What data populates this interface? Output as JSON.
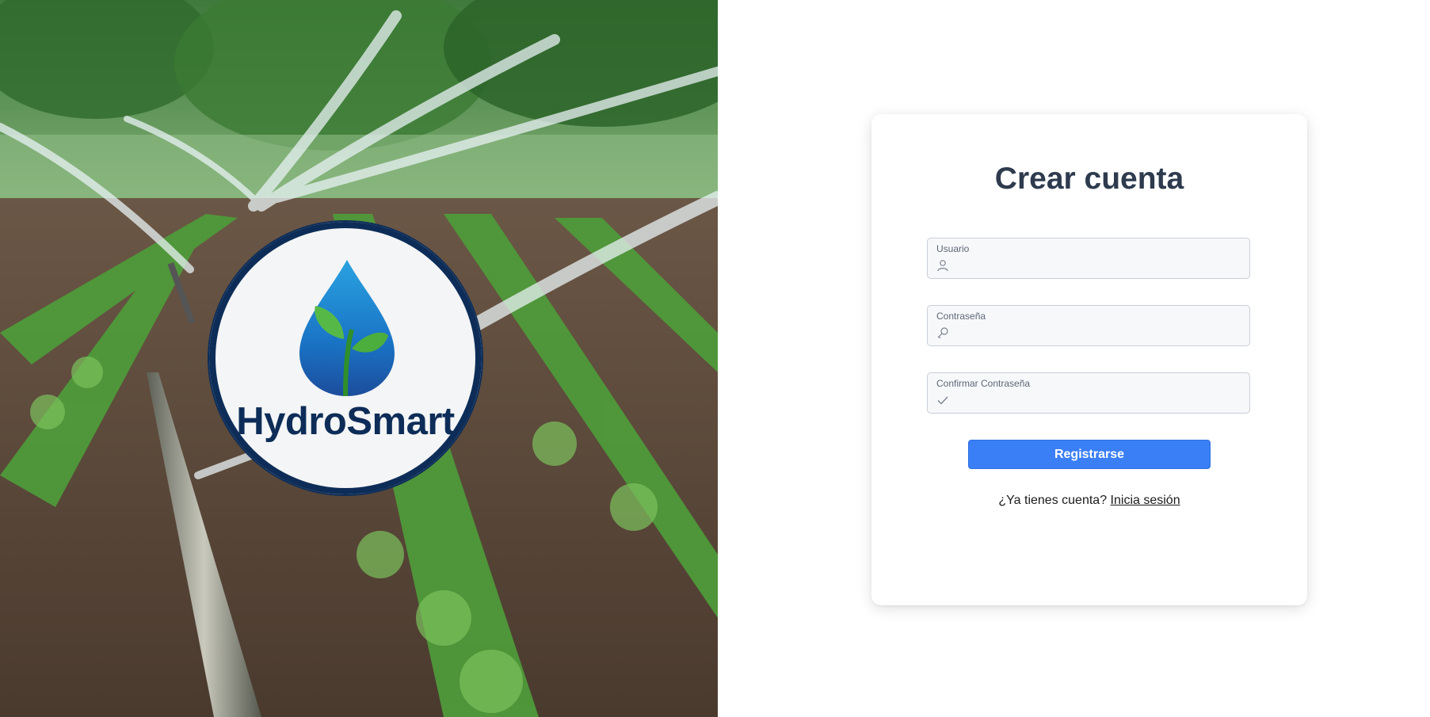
{
  "brand": {
    "name": "HydroSmart"
  },
  "form": {
    "title": "Crear cuenta",
    "fields": [
      {
        "label": "Usuario",
        "value": "",
        "icon": "user-icon"
      },
      {
        "label": "Contraseña",
        "value": "",
        "icon": "key-icon"
      },
      {
        "label": "Confirmar Contraseña",
        "value": "",
        "icon": "check-icon"
      }
    ],
    "submit_label": "Registrarse",
    "login_prompt": "¿Ya tienes cuenta?",
    "login_link": "Inicia sesión"
  },
  "colors": {
    "accent": "#3a7ff6",
    "title": "#2e3b4e",
    "brand_navy": "#0d2d58",
    "field_bg": "#f7f8fa"
  }
}
